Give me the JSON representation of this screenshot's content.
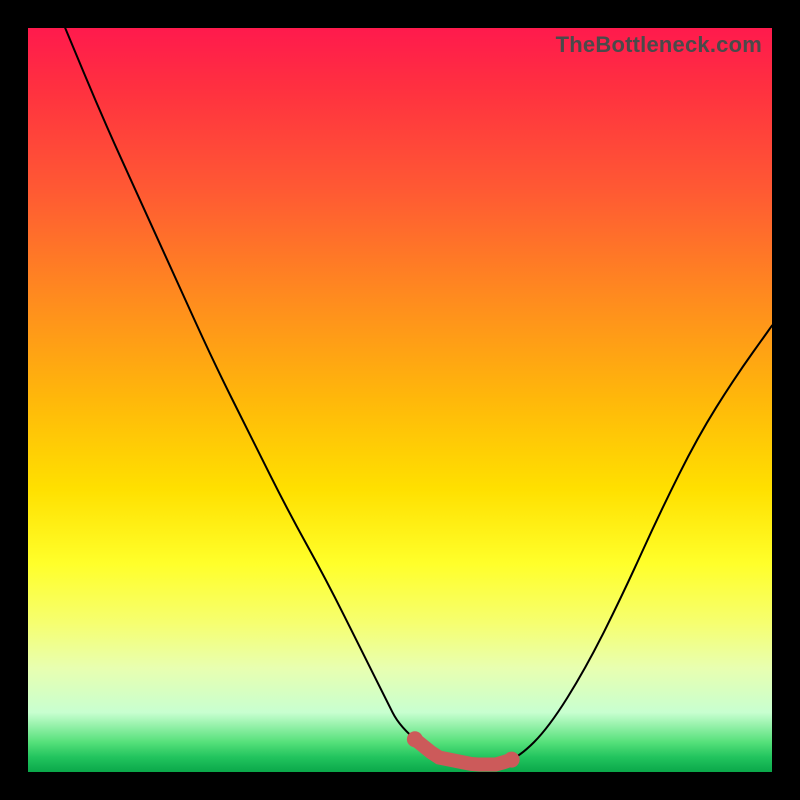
{
  "watermark": "TheBottleneck.com",
  "chart_data": {
    "type": "line",
    "title": "",
    "xlabel": "",
    "ylabel": "",
    "xlim": [
      0,
      100
    ],
    "ylim": [
      0,
      100
    ],
    "grid": false,
    "legend": false,
    "series": [
      {
        "name": "bottleneck-curve",
        "x": [
          5,
          10,
          15,
          20,
          25,
          30,
          35,
          40,
          45,
          48,
          50,
          55,
          60,
          63,
          66,
          70,
          75,
          80,
          85,
          90,
          95,
          100
        ],
        "values": [
          100,
          88,
          77,
          66,
          55,
          45,
          35,
          26,
          16,
          10,
          6,
          2,
          1,
          1,
          2,
          6,
          14,
          24,
          35,
          45,
          53,
          60
        ]
      }
    ],
    "highlight": {
      "name": "optimal-range",
      "x_start": 52,
      "x_end": 65,
      "color": "#cc5a5a"
    },
    "annotations": [],
    "colors": {
      "gradient_top": "#ff1a4d",
      "gradient_bottom": "#0aa84a",
      "curve": "#000000",
      "highlight": "#cc5a5a",
      "frame": "#000000"
    }
  }
}
